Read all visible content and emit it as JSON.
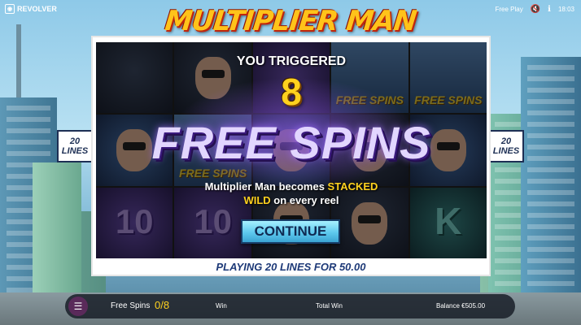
{
  "brand": {
    "name": "REVOLVER"
  },
  "topbar": {
    "mode": "Free Play",
    "time": "18:03"
  },
  "logo": {
    "text": "MULTIPLIER MAN"
  },
  "side_badges": {
    "left": "20\nLINES",
    "right": "20\nLINES"
  },
  "reels": {
    "cells": [
      {
        "kind": "dark"
      },
      {
        "kind": "dark"
      },
      {
        "kind": "purple"
      },
      {
        "kind": "city",
        "text": "FREE SPINS"
      },
      {
        "kind": "city",
        "text": "FREE SPINS"
      },
      {
        "kind": "blue"
      },
      {
        "kind": "city",
        "text": "FREE SPINS"
      },
      {
        "kind": "blue"
      },
      {
        "kind": "dark"
      },
      {
        "kind": "blue"
      },
      {
        "kind": "purple",
        "num": "10"
      },
      {
        "kind": "purple",
        "num": "10"
      },
      {
        "kind": "dark"
      },
      {
        "kind": "dark"
      },
      {
        "kind": "teal",
        "k": "K"
      }
    ]
  },
  "popup": {
    "triggered": "YOU TRIGGERED",
    "count": "8",
    "title": "FREE SPINS",
    "desc_1": "Multiplier Man becomes ",
    "desc_highlight_1": "STACKED",
    "desc_highlight_2": "WILD",
    "desc_2": " on every reel",
    "continue": "CONTINUE"
  },
  "playing": "PLAYING 20 LINES FOR 50.00",
  "bottombar": {
    "free_spins_label": "Free Spins",
    "free_spins_value": "0/8",
    "win_label": "Win",
    "total_win_label": "Total Win",
    "balance_label": "Balance €505.00"
  },
  "colors": {
    "accent": "#ffd21e",
    "continue_btn": "#5ec9ee",
    "popup_frame": "#ffffff"
  }
}
